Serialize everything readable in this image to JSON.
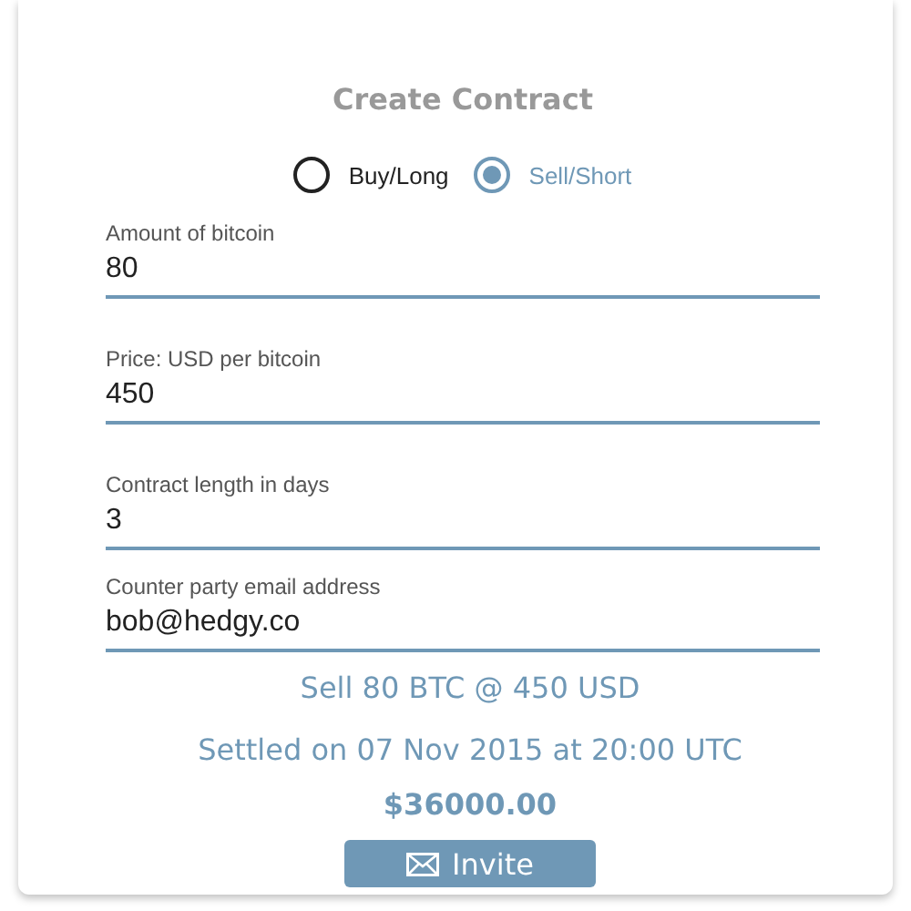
{
  "title": "Create Contract",
  "position_options": [
    {
      "label": "Buy/Long",
      "selected": false
    },
    {
      "label": "Sell/Short",
      "selected": true
    }
  ],
  "fields": [
    {
      "label": "Amount of bitcoin",
      "value": "80"
    },
    {
      "label": "Price: USD per bitcoin",
      "value": "450"
    },
    {
      "label": "Contract length in days",
      "value": "3"
    },
    {
      "label": "Counter party email address",
      "value": "bob@hedgy.co"
    }
  ],
  "summary": "Sell 80 BTC @ 450 USD",
  "settlement": "Settled on 07 Nov 2015 at 20:00 UTC",
  "total": "$36000.00",
  "invite_button": {
    "label": "Invite"
  }
}
